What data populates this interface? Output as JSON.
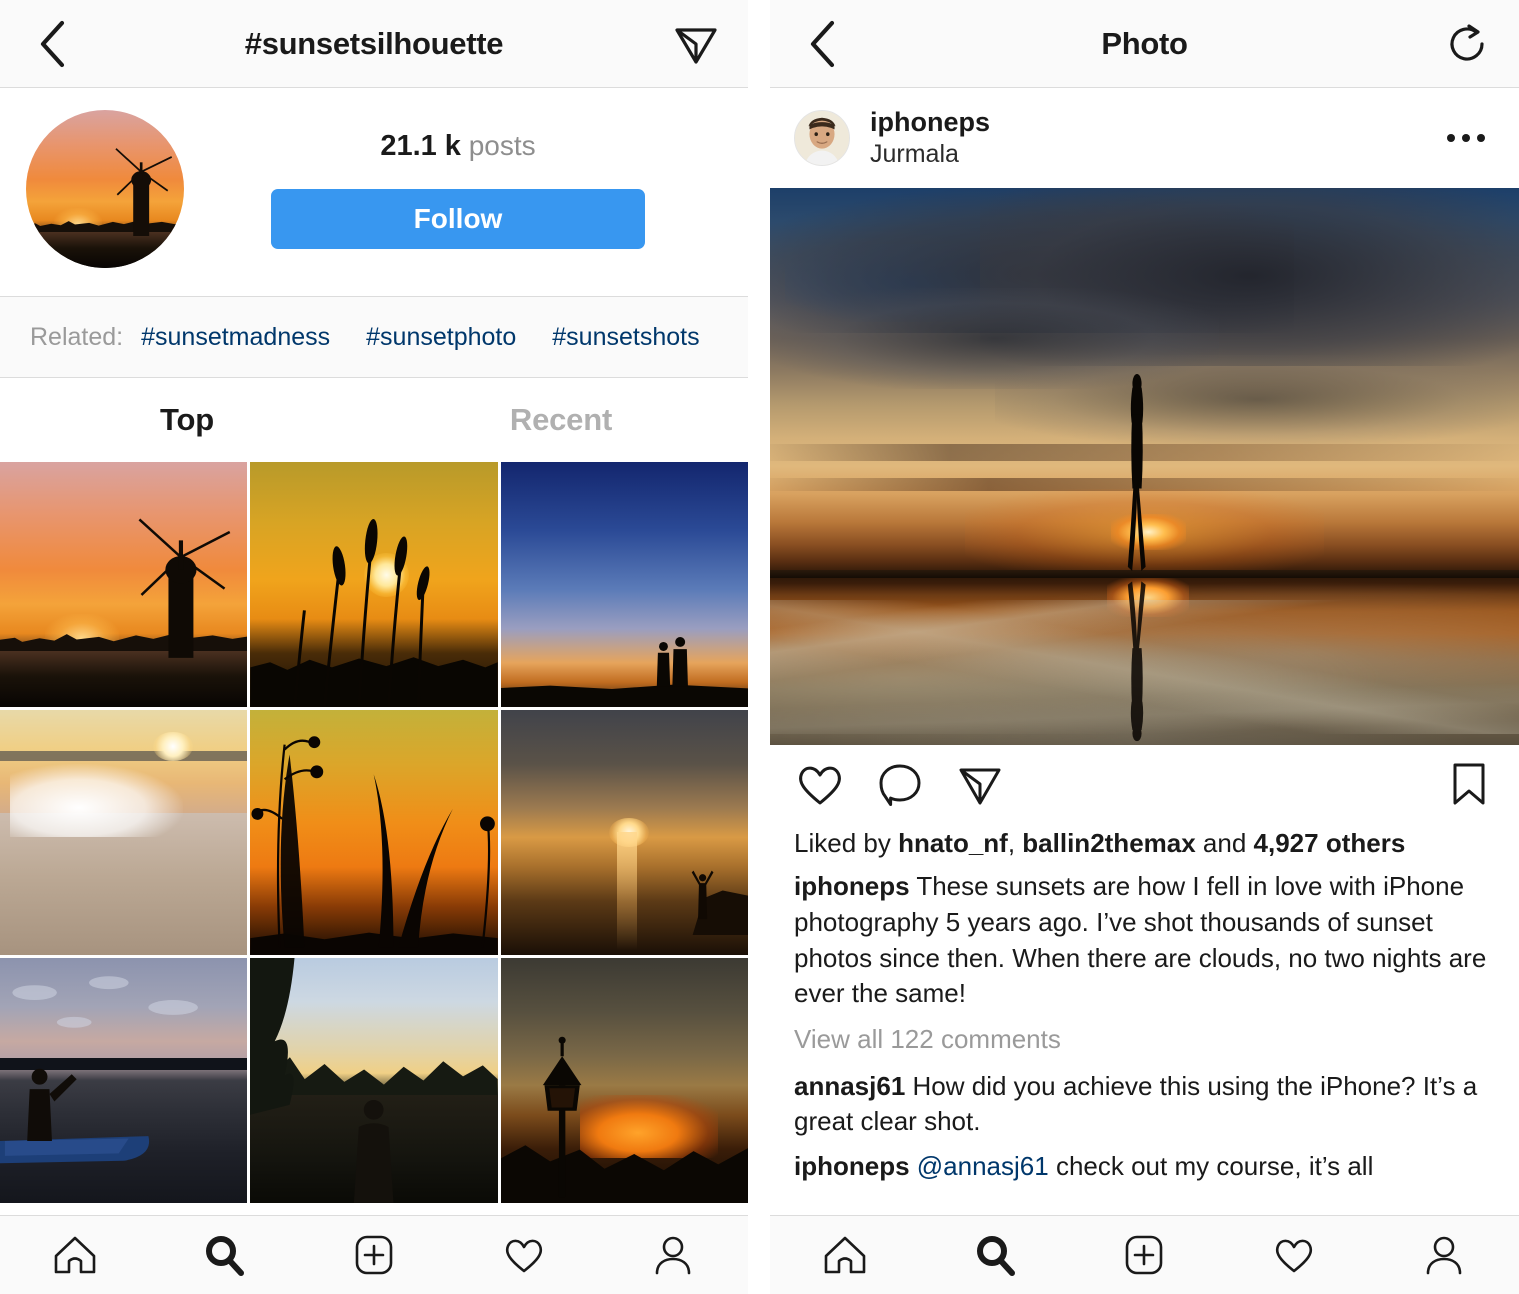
{
  "left": {
    "navbar": {
      "back_icon": "chevron-left-icon",
      "title": "#sunsetsilhouette",
      "share_icon": "paper-plane-icon"
    },
    "hashtag_profile": {
      "avatar_alt": "windmill-sunset-avatar",
      "posts_count": "21.1 k",
      "posts_label": "posts",
      "follow_label": "Follow"
    },
    "related": {
      "label": "Related:",
      "tags": [
        "#sunsetmadness",
        "#sunsetphoto",
        "#sunsetshots"
      ]
    },
    "tabs": [
      {
        "label": "Top",
        "active": true
      },
      {
        "label": "Recent",
        "active": false
      }
    ],
    "grid": [
      {
        "alt": "windmill-silhouette-sunset",
        "art": "art-windmill"
      },
      {
        "alt": "grass-stalks-sun-sunset",
        "art": "art-grass"
      },
      {
        "alt": "couple-silhouette-blue-dusk",
        "art": "art-couple"
      },
      {
        "alt": "crashing-wave-sunset",
        "art": "art-wave"
      },
      {
        "alt": "reeds-orange-sunset",
        "art": "art-reeds"
      },
      {
        "alt": "person-sea-sunset",
        "art": "art-sea"
      },
      {
        "alt": "boat-lake-dusk",
        "art": "art-boat"
      },
      {
        "alt": "person-forest-lake-sunset",
        "art": "art-forest"
      },
      {
        "alt": "street-lamp-fiery-sunset",
        "art": "art-lamp"
      }
    ],
    "tabbar": [
      {
        "icon": "home-icon",
        "active": false
      },
      {
        "icon": "search-icon",
        "active": true
      },
      {
        "icon": "add-post-icon",
        "active": false
      },
      {
        "icon": "heart-icon",
        "active": false
      },
      {
        "icon": "profile-icon",
        "active": false
      }
    ]
  },
  "right": {
    "navbar": {
      "back_icon": "chevron-left-icon",
      "title": "Photo",
      "refresh_icon": "refresh-icon"
    },
    "post": {
      "avatar_alt": "iphoneps-profile-photo",
      "username": "iphoneps",
      "location": "Jurmala",
      "more_icon": "more-options-icon",
      "photo_alt": "woman-silhouette-walking-on-reflective-beach-at-sunset",
      "actions": {
        "like_icon": "heart-icon",
        "comment_icon": "comment-bubble-icon",
        "share_icon": "paper-plane-icon",
        "save_icon": "bookmark-icon"
      },
      "likes": {
        "prefix": "Liked by ",
        "user1": "hnato_nf",
        "separator": ", ",
        "user2": "ballin2themax",
        "middle": " and ",
        "others": "4,927 others"
      },
      "caption": {
        "author": "iphoneps",
        "text": " These sunsets are how I fell in love with iPhone photography 5 years ago. I’ve shot thousands of sunset photos since then. When there are clouds, no two nights are ever the same!"
      },
      "view_comments": "View all 122 comments",
      "comments": [
        {
          "author": "annasj61",
          "mention": "",
          "text": " How did you achieve this using the iPhone? It’s a great clear shot."
        },
        {
          "author": "iphoneps",
          "mention": " @annasj61",
          "text": " check out my course, it’s all"
        }
      ]
    },
    "tabbar": [
      {
        "icon": "home-icon",
        "active": false
      },
      {
        "icon": "search-icon",
        "active": true
      },
      {
        "icon": "add-post-icon",
        "active": false
      },
      {
        "icon": "heart-icon",
        "active": false
      },
      {
        "icon": "profile-icon",
        "active": false
      }
    ]
  },
  "colors": {
    "accent_blue": "#3897f0",
    "link_navy": "#00376b",
    "muted_gray": "#9a9a9a",
    "bar_bg": "#fafafa",
    "text": "#1a1a1a"
  }
}
